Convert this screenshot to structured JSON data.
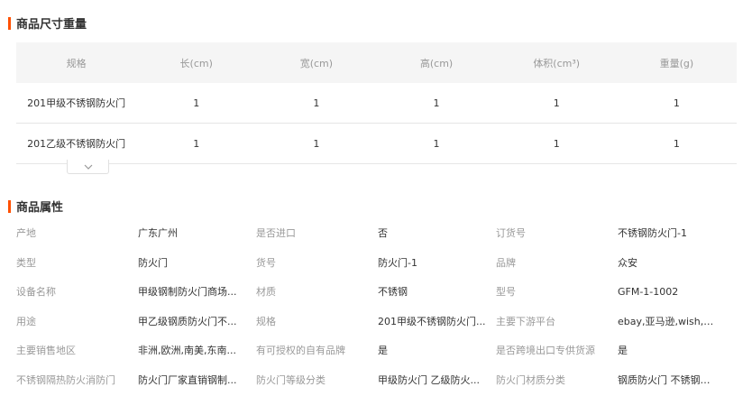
{
  "dimensions": {
    "title": "商品尺寸重量",
    "headers": [
      "规格",
      "长(cm)",
      "宽(cm)",
      "高(cm)",
      "体积(cm³)",
      "重量(g)"
    ],
    "rows": [
      [
        "201甲级不锈钢防火门",
        "1",
        "1",
        "1",
        "1",
        "1"
      ],
      [
        "201乙级不锈钢防火门",
        "1",
        "1",
        "1",
        "1",
        "1"
      ]
    ],
    "expand_icon": "chevron-down-icon"
  },
  "attributes": {
    "title": "商品属性",
    "rows": [
      [
        [
          "产地",
          "广东广州"
        ],
        [
          "是否进口",
          "否"
        ],
        [
          "订货号",
          "不锈钢防火门-1"
        ]
      ],
      [
        [
          "类型",
          "防火门"
        ],
        [
          "货号",
          "防火门-1"
        ],
        [
          "品牌",
          "众安"
        ]
      ],
      [
        [
          "设备名称",
          "甲级钢制防火门商场..."
        ],
        [
          "材质",
          "不锈钢"
        ],
        [
          "型号",
          "GFM-1-1002"
        ]
      ],
      [
        [
          "用途",
          "甲乙级钢质防火门不..."
        ],
        [
          "规格",
          "201甲级不锈钢防火门..."
        ],
        [
          "主要下游平台",
          "ebay,亚马逊,wish,速..."
        ]
      ],
      [
        [
          "主要销售地区",
          "非洲,欧洲,南美,东南..."
        ],
        [
          "有可授权的自有品牌",
          "是"
        ],
        [
          "是否跨境出口专供货源",
          "是"
        ]
      ],
      [
        [
          "不锈钢隔热防火消防门",
          "防火门厂家直销钢制..."
        ],
        [
          "防火门等级分类",
          "甲级防火门 乙级防火..."
        ],
        [
          "防火门材质分类",
          "钢质防火门 不锈钢防..."
        ]
      ]
    ]
  },
  "colors": {
    "accent": "#ff5000",
    "header_bg": "#f5f5f5",
    "label": "#999999"
  }
}
